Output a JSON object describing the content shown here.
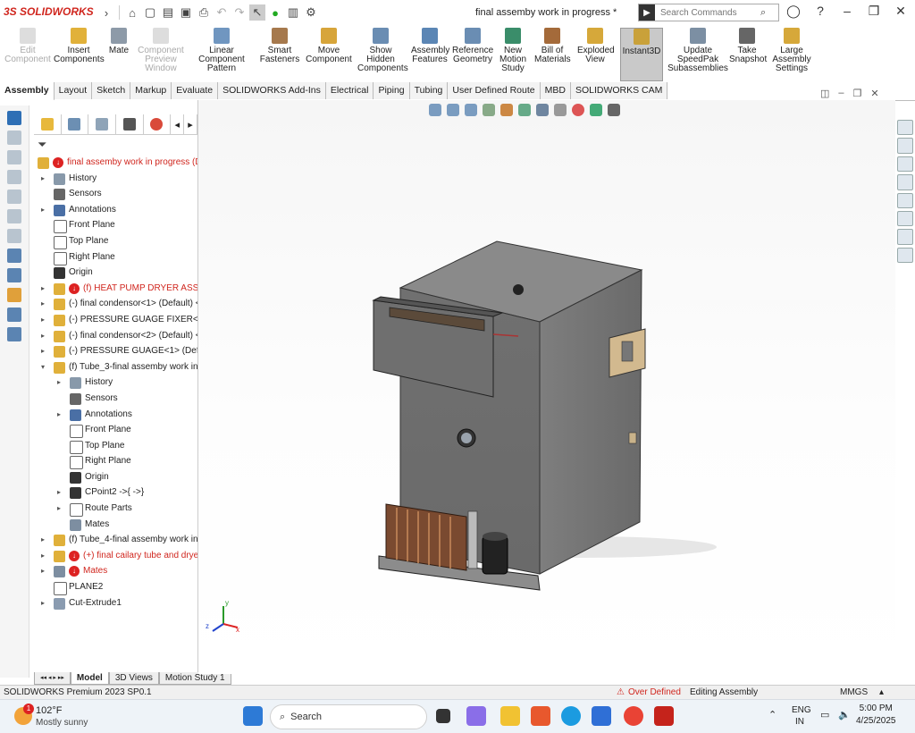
{
  "app": {
    "logo": "3S SOLIDWORKS",
    "doc_title": "final assemby work in progress *"
  },
  "search": {
    "placeholder": "Search Commands"
  },
  "ribbon": {
    "buttons": [
      {
        "label": "Edit Component",
        "disabled": true
      },
      {
        "label": "Insert Components"
      },
      {
        "label": "Mate"
      },
      {
        "label": "Component Preview Window",
        "disabled": true
      },
      {
        "label": "Linear Component Pattern"
      },
      {
        "label": "Smart Fasteners"
      },
      {
        "label": "Move Component"
      },
      {
        "label": "Show Hidden Components"
      },
      {
        "label": "Assembly Features"
      },
      {
        "label": "Reference Geometry"
      },
      {
        "label": "New Motion Study"
      },
      {
        "label": "Bill of Materials"
      },
      {
        "label": "Exploded View"
      },
      {
        "label": "Instant3D",
        "active": true
      },
      {
        "label": "Update SpeedPak Subassemblies"
      },
      {
        "label": "Take Snapshot"
      },
      {
        "label": "Large Assembly Settings"
      }
    ]
  },
  "tabs": [
    "Assembly",
    "Layout",
    "Sketch",
    "Markup",
    "Evaluate",
    "SOLIDWORKS Add-Ins",
    "Electrical",
    "Piping",
    "Tubing",
    "User Defined Route",
    "MBD",
    "SOLIDWORKS CAM"
  ],
  "tree": [
    {
      "text": "final assemby work in progress (D",
      "level": 0,
      "icon": "assembly",
      "red": true,
      "warn": true
    },
    {
      "text": "History",
      "level": 1,
      "icon": "history",
      "tw": true
    },
    {
      "text": "Sensors",
      "level": 1,
      "icon": "sensor"
    },
    {
      "text": "Annotations",
      "level": 1,
      "icon": "annotation",
      "tw": true
    },
    {
      "text": "Front Plane",
      "level": 1,
      "icon": "plane"
    },
    {
      "text": "Top Plane",
      "level": 1,
      "icon": "plane"
    },
    {
      "text": "Right Plane",
      "level": 1,
      "icon": "plane"
    },
    {
      "text": "Origin",
      "level": 1,
      "icon": "origin"
    },
    {
      "text": "(f) HEAT PUMP DRYER ASSEN",
      "level": 1,
      "icon": "assembly",
      "red": true,
      "warn": true,
      "tw": true
    },
    {
      "text": "(-) final condensor<1> (Default) <",
      "level": 1,
      "icon": "assembly",
      "tw": true
    },
    {
      "text": "(-) PRESSURE GUAGE FIXER<1> (D",
      "level": 1,
      "icon": "part",
      "tw": true
    },
    {
      "text": "(-) final condensor<2> (Default) <",
      "level": 1,
      "icon": "assembly",
      "tw": true
    },
    {
      "text": "(-) PRESSURE GUAGE<1> (Default",
      "level": 1,
      "icon": "part",
      "tw": true
    },
    {
      "text": "(f) Tube_3-final assemby work in p",
      "level": 1,
      "icon": "assembly",
      "tw": true,
      "open": true
    },
    {
      "text": "History",
      "level": 2,
      "icon": "history",
      "tw": true
    },
    {
      "text": "Sensors",
      "level": 2,
      "icon": "sensor"
    },
    {
      "text": "Annotations",
      "level": 2,
      "icon": "annotation",
      "tw": true
    },
    {
      "text": "Front Plane",
      "level": 2,
      "icon": "plane"
    },
    {
      "text": "Top Plane",
      "level": 2,
      "icon": "plane"
    },
    {
      "text": "Right Plane",
      "level": 2,
      "icon": "plane"
    },
    {
      "text": "Origin",
      "level": 2,
      "icon": "origin"
    },
    {
      "text": "CPoint2 ->{ ->}",
      "level": 2,
      "icon": "cpoint",
      "tw": true
    },
    {
      "text": "Route Parts",
      "level": 2,
      "icon": "folder",
      "tw": true
    },
    {
      "text": "Mates",
      "level": 2,
      "icon": "mates"
    },
    {
      "text": "(f) Tube_4-final assemby work in p",
      "level": 1,
      "icon": "assembly",
      "tw": true
    },
    {
      "text": "(+) final cailary tube and drye",
      "level": 1,
      "icon": "assembly",
      "red": true,
      "warn": true,
      "tw": true
    },
    {
      "text": "Mates",
      "level": 1,
      "icon": "mates",
      "red": true,
      "warn": true,
      "tw": true
    },
    {
      "text": "PLANE2",
      "level": 1,
      "icon": "plane"
    },
    {
      "text": "Cut-Extrude1",
      "level": 1,
      "icon": "cut",
      "tw": true
    }
  ],
  "bottom_tabs": [
    "Model",
    "3D Views",
    "Motion Study 1"
  ],
  "status": {
    "version": "SOLIDWORKS Premium 2023 SP0.1",
    "warning": "Over Defined",
    "mode": "Editing Assembly",
    "units": "MMGS"
  },
  "taskbar": {
    "temp": "102°F",
    "weather": "Mostly sunny",
    "search_label": "Search",
    "lang1": "ENG",
    "lang2": "IN",
    "time": "5:00 PM",
    "date": "4/25/2025",
    "badge": "1"
  },
  "axis": {
    "x": "x",
    "y": "y",
    "z": "z"
  }
}
